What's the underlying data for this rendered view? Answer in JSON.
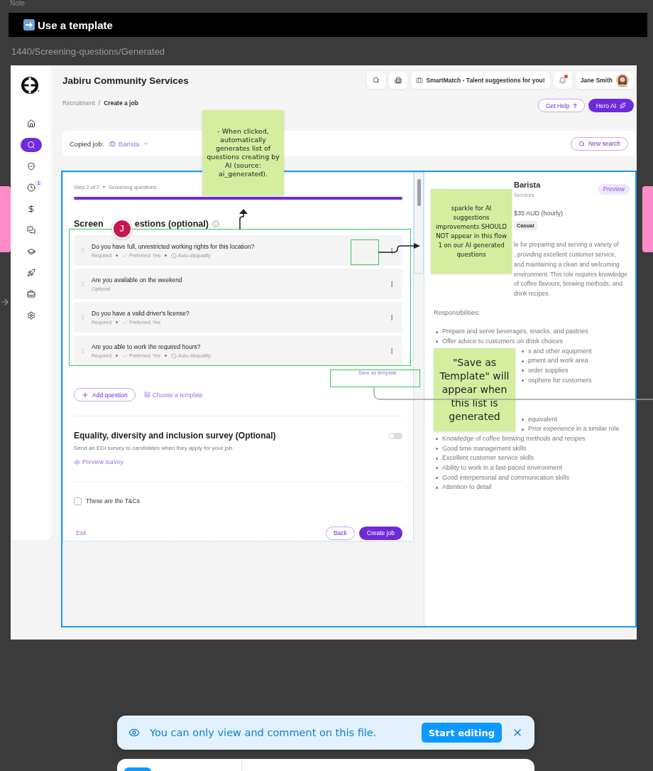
{
  "canvas": {
    "top_label": "Note",
    "banner": {
      "title": "Use a template"
    },
    "frame_label": "1440/Screening-questions/Generated"
  },
  "sidebar": {
    "items": [
      {
        "selected": false
      },
      {
        "selected": true
      },
      {
        "selected": false
      },
      {
        "selected": false,
        "badge": "1"
      },
      {
        "selected": false
      },
      {
        "selected": false
      },
      {
        "selected": false
      },
      {
        "selected": false
      },
      {
        "selected": false
      },
      {
        "selected": false
      }
    ]
  },
  "header": {
    "org_name": "Jabiru Community Services",
    "breadcrumb": {
      "parent": "Recruitment",
      "separator": "/",
      "current": "Create a job"
    },
    "smartmatch": "SmartMatch - Talent suggestions for you!",
    "notifications_unread": true,
    "user": "Jane Smith",
    "help_button": "Get Help",
    "help_mark": "?",
    "ai_button": "Hero AI"
  },
  "copied_job": {
    "label": "Copied job:",
    "value": "Barista",
    "button": "New search"
  },
  "form": {
    "step": "Step 2 of 2",
    "step_name": "Screening questions",
    "progress": {
      "level": 1
    },
    "title_parts": [
      "Screen",
      "estions (optional)"
    ],
    "collaborator": {
      "initial": "J"
    },
    "questions": [
      {
        "text": "Do you have full, unrestricted working rights for this location?",
        "meta": [
          {
            "kind": "plain",
            "label": "Required"
          },
          {
            "kind": "check",
            "label": "Preferred: Yes"
          },
          {
            "kind": "ban",
            "label": "Auto-disqualify"
          }
        ]
      },
      {
        "text": "Are you available on the weekend",
        "meta": [
          {
            "kind": "plain",
            "label": "Optional"
          }
        ]
      },
      {
        "text": "Do you have a valid driver's license?",
        "meta": [
          {
            "kind": "plain",
            "label": "Required"
          },
          {
            "kind": "check",
            "label": "Preferred: Yes"
          }
        ]
      },
      {
        "text": "Are you able to work the required hours?",
        "meta": [
          {
            "kind": "plain",
            "label": "Required"
          },
          {
            "kind": "check",
            "label": "Preferred: Yes"
          },
          {
            "kind": "ban",
            "label": "Auto-disqualify"
          }
        ]
      }
    ],
    "save_template": "Save as template",
    "add_question": "Add question",
    "choose_template": "Choose a template",
    "edi": {
      "title": "Equality, diversity and inclusion survey (Optional)",
      "on": false,
      "description": "Send an EDI survey to candidates when they apply for your job.",
      "preview": "Preview survey"
    },
    "terms": {
      "label": "These are the T&Cs",
      "checked": false
    },
    "footer": {
      "exit": "Exit",
      "back": "Back",
      "create": "Create job"
    }
  },
  "preview": {
    "title": "Barista",
    "badge": "Preview",
    "company": "Services",
    "pay": "$35 AUD (hourly)",
    "tag": "Casual",
    "description": [
      "le for preparing and serving a variety of",
      ", providing excellent customer service,",
      "and maintaining a clean and welcoming environment. This role requires knowledge of coffee flavours, brewing methods, and drink recipes."
    ],
    "responsibilities_label": "Responsibilities:",
    "responsibilities": [
      "Prepare and serve beverages, snacks, and pastries",
      "Offer advice to customers on drink choices",
      "s and other equipment",
      "pment and work area",
      "order supplies",
      "osphere for customers"
    ],
    "requirements": [
      "equivalent",
      "Prior experience in a similar role",
      "Knowledge of coffee brewing methods and recipes",
      "Good time management skills",
      "Excellent customer service skills",
      "Ability to work in a fast-paced environment",
      "Good interpersonal and communication skills",
      "Attention to detail"
    ]
  },
  "sticky_notes": [
    {
      "text": "- When clicked, automatically generates list of questions creating by AI (source: ai_generated)."
    },
    {
      "text": "sparkle for AI suggestions improvements SHOULD NOT appear in this flow 1 on our AI generated questions"
    },
    {
      "text": "\"Save as Template\" will appear when this list is generated"
    }
  ],
  "toast": {
    "message": "You can only view and comment on this file.",
    "button": "Start editing"
  }
}
